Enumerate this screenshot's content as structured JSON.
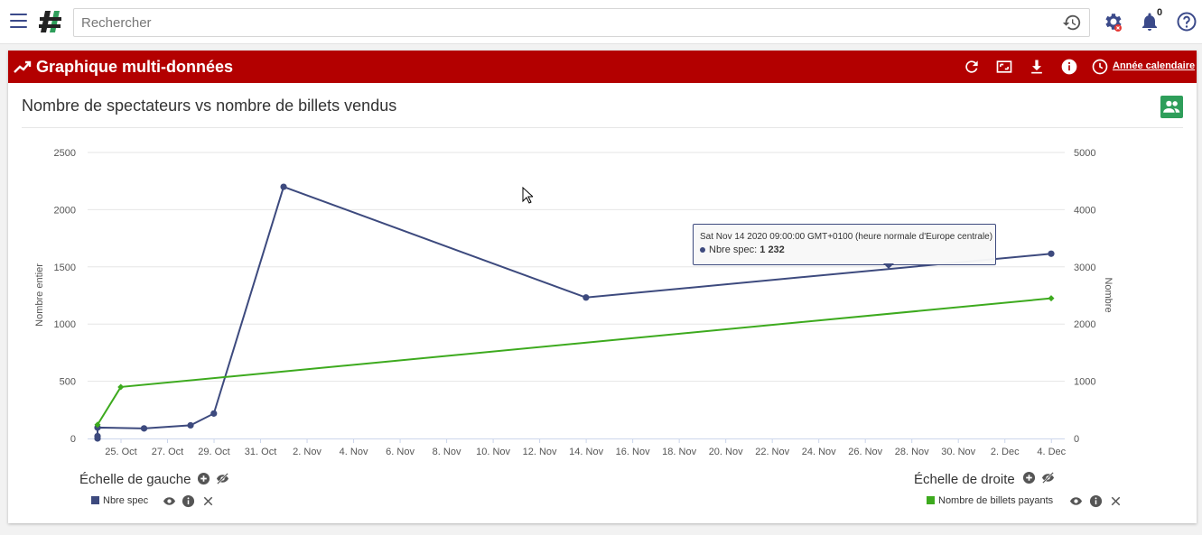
{
  "topbar": {
    "search_placeholder": "Rechercher",
    "notification_count": "0",
    "icons": [
      "menu-icon",
      "app-logo",
      "history-icon",
      "settings-gear-icon",
      "notification-bell-icon",
      "help-icon"
    ]
  },
  "panel": {
    "title": "Graphique multi-données",
    "calendar_label": "Année calendaire",
    "header_color": "#b30000",
    "icons": [
      "refresh-icon",
      "fullscreen-icon",
      "download-icon",
      "info-icon",
      "clock-icon"
    ]
  },
  "chart_title": "Nombre de spectateurs vs nombre de billets vendus",
  "tooltip": {
    "date": "Sat Nov 14 2020 09:00:00 GMT+0100 (heure normale d'Europe centrale)",
    "series": "Nbre spec:",
    "value": "1 232"
  },
  "chart_data": {
    "type": "line",
    "title": "Nombre de spectateurs vs nombre de billets vendus",
    "y_left": {
      "label": "Nombre entier",
      "range": [
        0,
        2500
      ],
      "ticks": [
        "0",
        "500",
        "1000",
        "1500",
        "2000",
        "2500"
      ]
    },
    "y_right": {
      "label": "Nombre",
      "range": [
        0,
        5000
      ],
      "ticks": [
        "0",
        "1000",
        "2000",
        "3000",
        "4000",
        "5000"
      ]
    },
    "x_ticks": [
      "25. Oct",
      "27. Oct",
      "29. Oct",
      "31. Oct",
      "2. Nov",
      "4. Nov",
      "6. Nov",
      "8. Nov",
      "10. Nov",
      "12. Nov",
      "14. Nov",
      "16. Nov",
      "18. Nov",
      "20. Nov",
      "22. Nov",
      "24. Nov",
      "26. Nov",
      "28. Nov",
      "30. Nov",
      "2. Dec",
      "4. Dec"
    ],
    "grid": true,
    "series": [
      {
        "name": "Nbre spec",
        "axis": "left",
        "color": "#3d4a7e",
        "points": [
          [
            "2020-10-24",
            0
          ],
          [
            "2020-10-24",
            20
          ],
          [
            "2020-10-24",
            95
          ],
          [
            "2020-10-26",
            88
          ],
          [
            "2020-10-28",
            115
          ],
          [
            "2020-10-29",
            218
          ],
          [
            "2020-11-01",
            2200
          ],
          [
            "2020-11-14",
            1232
          ],
          [
            "2020-12-04",
            1615
          ]
        ]
      },
      {
        "name": "Nombre de billets payants",
        "axis": "right",
        "color": "#3daa1e",
        "points": [
          [
            "2020-10-24",
            240
          ],
          [
            "2020-10-25",
            900
          ],
          [
            "2020-12-04",
            2450
          ]
        ]
      }
    ]
  },
  "left_scale": {
    "title": "Échelle de gauche",
    "legend": "Nbre spec",
    "color": "#3d4a7e"
  },
  "right_scale": {
    "title": "Échelle de droite",
    "legend": "Nombre de billets payants",
    "color": "#3daa1e"
  }
}
